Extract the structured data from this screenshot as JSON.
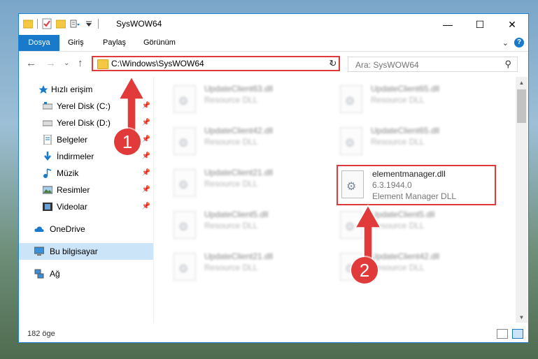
{
  "window": {
    "title": "SysWOW64",
    "minimize": "—",
    "maximize": "☐",
    "close": "✕"
  },
  "ribbon": {
    "tabs": [
      "Dosya",
      "Giriş",
      "Paylaş",
      "Görünüm"
    ],
    "collapse": "⌄",
    "help": "?"
  },
  "nav": {
    "back": "←",
    "forward": "→",
    "recent": "⌄",
    "up": "↑",
    "address": "C:\\Windows\\SysWOW64",
    "address_dropdown": "⌄",
    "refresh": "↻",
    "search_placeholder": "Ara: SysWOW64",
    "search_icon": "⚲"
  },
  "sidebar": {
    "items": [
      {
        "label": "Hızlı erişim",
        "icon": "star-icon"
      },
      {
        "label": "Yerel Disk (C:)",
        "icon": "drive-icon",
        "pinned": true
      },
      {
        "label": "Yerel Disk (D:)",
        "icon": "drive-icon",
        "pinned": true
      },
      {
        "label": "Belgeler",
        "icon": "documents-icon",
        "pinned": true
      },
      {
        "label": "İndirmeler",
        "icon": "download-icon",
        "pinned": true
      },
      {
        "label": "Müzik",
        "icon": "music-icon",
        "pinned": true
      },
      {
        "label": "Resimler",
        "icon": "pictures-icon",
        "pinned": true
      },
      {
        "label": "Videolar",
        "icon": "video-icon",
        "pinned": true
      },
      {
        "label": "OneDrive",
        "icon": "cloud-icon"
      },
      {
        "label": "Bu bilgisayar",
        "icon": "computer-icon",
        "selected": true
      },
      {
        "label": "Ağ",
        "icon": "network-icon"
      }
    ],
    "pin_glyph": "📌"
  },
  "files": [
    {
      "name": "UpdateClient63.dll",
      "desc": "Resource DLL"
    },
    {
      "name": "UpdateClient65.dll",
      "desc": "Resource DLL"
    },
    {
      "name": "UpdateClient42.dll",
      "desc": "Resource DLL"
    },
    {
      "name": "UpdateClient65.dll",
      "desc": "Resource DLL"
    },
    {
      "name": "UpdateClient21.dll",
      "desc": "Resource DLL"
    },
    {
      "name": "elementmanager.dll",
      "version": "6.3.1944.0",
      "desc": "Element Manager DLL"
    },
    {
      "name": "UpdateClient5.dll",
      "desc": "Resource DLL"
    },
    {
      "name": "UpdateClient5.dll",
      "desc": "Resource DLL"
    },
    {
      "name": "UpdateClient21.dll",
      "desc": "Resource DLL"
    },
    {
      "name": "UpdateClient42.dll",
      "desc": "Resource DLL"
    }
  ],
  "status": {
    "count": "182 öge"
  },
  "annotations": {
    "step1": "1",
    "step2": "2",
    "accent": "#e03a3a"
  },
  "colors": {
    "accent": "#1979ca",
    "selection": "#cce4f7"
  }
}
